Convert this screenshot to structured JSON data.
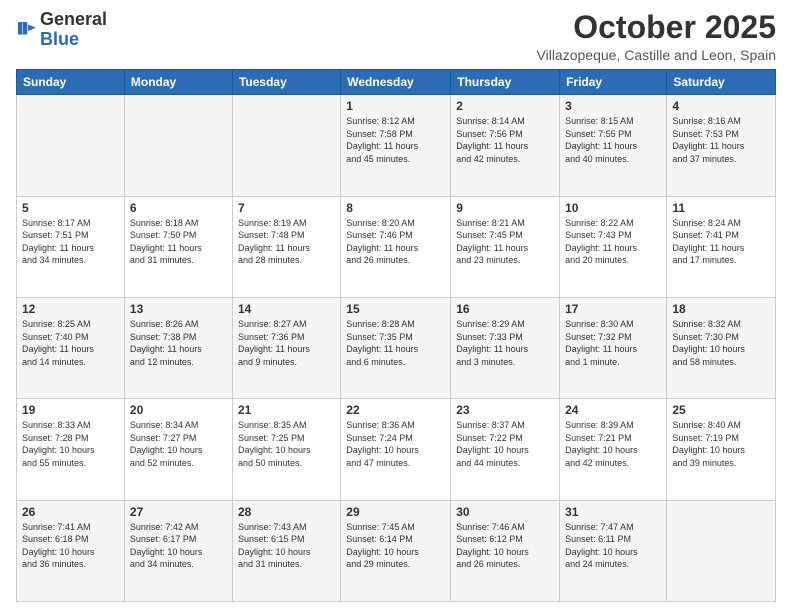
{
  "header": {
    "logo_general": "General",
    "logo_blue": "Blue",
    "month": "October 2025",
    "location": "Villazopeque, Castille and Leon, Spain"
  },
  "days_of_week": [
    "Sunday",
    "Monday",
    "Tuesday",
    "Wednesday",
    "Thursday",
    "Friday",
    "Saturday"
  ],
  "weeks": [
    [
      {
        "day": "",
        "info": ""
      },
      {
        "day": "",
        "info": ""
      },
      {
        "day": "",
        "info": ""
      },
      {
        "day": "1",
        "info": "Sunrise: 8:12 AM\nSunset: 7:58 PM\nDaylight: 11 hours\nand 45 minutes."
      },
      {
        "day": "2",
        "info": "Sunrise: 8:14 AM\nSunset: 7:56 PM\nDaylight: 11 hours\nand 42 minutes."
      },
      {
        "day": "3",
        "info": "Sunrise: 8:15 AM\nSunset: 7:55 PM\nDaylight: 11 hours\nand 40 minutes."
      },
      {
        "day": "4",
        "info": "Sunrise: 8:16 AM\nSunset: 7:53 PM\nDaylight: 11 hours\nand 37 minutes."
      }
    ],
    [
      {
        "day": "5",
        "info": "Sunrise: 8:17 AM\nSunset: 7:51 PM\nDaylight: 11 hours\nand 34 minutes."
      },
      {
        "day": "6",
        "info": "Sunrise: 8:18 AM\nSunset: 7:50 PM\nDaylight: 11 hours\nand 31 minutes."
      },
      {
        "day": "7",
        "info": "Sunrise: 8:19 AM\nSunset: 7:48 PM\nDaylight: 11 hours\nand 28 minutes."
      },
      {
        "day": "8",
        "info": "Sunrise: 8:20 AM\nSunset: 7:46 PM\nDaylight: 11 hours\nand 26 minutes."
      },
      {
        "day": "9",
        "info": "Sunrise: 8:21 AM\nSunset: 7:45 PM\nDaylight: 11 hours\nand 23 minutes."
      },
      {
        "day": "10",
        "info": "Sunrise: 8:22 AM\nSunset: 7:43 PM\nDaylight: 11 hours\nand 20 minutes."
      },
      {
        "day": "11",
        "info": "Sunrise: 8:24 AM\nSunset: 7:41 PM\nDaylight: 11 hours\nand 17 minutes."
      }
    ],
    [
      {
        "day": "12",
        "info": "Sunrise: 8:25 AM\nSunset: 7:40 PM\nDaylight: 11 hours\nand 14 minutes."
      },
      {
        "day": "13",
        "info": "Sunrise: 8:26 AM\nSunset: 7:38 PM\nDaylight: 11 hours\nand 12 minutes."
      },
      {
        "day": "14",
        "info": "Sunrise: 8:27 AM\nSunset: 7:36 PM\nDaylight: 11 hours\nand 9 minutes."
      },
      {
        "day": "15",
        "info": "Sunrise: 8:28 AM\nSunset: 7:35 PM\nDaylight: 11 hours\nand 6 minutes."
      },
      {
        "day": "16",
        "info": "Sunrise: 8:29 AM\nSunset: 7:33 PM\nDaylight: 11 hours\nand 3 minutes."
      },
      {
        "day": "17",
        "info": "Sunrise: 8:30 AM\nSunset: 7:32 PM\nDaylight: 11 hours\nand 1 minute."
      },
      {
        "day": "18",
        "info": "Sunrise: 8:32 AM\nSunset: 7:30 PM\nDaylight: 10 hours\nand 58 minutes."
      }
    ],
    [
      {
        "day": "19",
        "info": "Sunrise: 8:33 AM\nSunset: 7:28 PM\nDaylight: 10 hours\nand 55 minutes."
      },
      {
        "day": "20",
        "info": "Sunrise: 8:34 AM\nSunset: 7:27 PM\nDaylight: 10 hours\nand 52 minutes."
      },
      {
        "day": "21",
        "info": "Sunrise: 8:35 AM\nSunset: 7:25 PM\nDaylight: 10 hours\nand 50 minutes."
      },
      {
        "day": "22",
        "info": "Sunrise: 8:36 AM\nSunset: 7:24 PM\nDaylight: 10 hours\nand 47 minutes."
      },
      {
        "day": "23",
        "info": "Sunrise: 8:37 AM\nSunset: 7:22 PM\nDaylight: 10 hours\nand 44 minutes."
      },
      {
        "day": "24",
        "info": "Sunrise: 8:39 AM\nSunset: 7:21 PM\nDaylight: 10 hours\nand 42 minutes."
      },
      {
        "day": "25",
        "info": "Sunrise: 8:40 AM\nSunset: 7:19 PM\nDaylight: 10 hours\nand 39 minutes."
      }
    ],
    [
      {
        "day": "26",
        "info": "Sunrise: 7:41 AM\nSunset: 6:18 PM\nDaylight: 10 hours\nand 36 minutes."
      },
      {
        "day": "27",
        "info": "Sunrise: 7:42 AM\nSunset: 6:17 PM\nDaylight: 10 hours\nand 34 minutes."
      },
      {
        "day": "28",
        "info": "Sunrise: 7:43 AM\nSunset: 6:15 PM\nDaylight: 10 hours\nand 31 minutes."
      },
      {
        "day": "29",
        "info": "Sunrise: 7:45 AM\nSunset: 6:14 PM\nDaylight: 10 hours\nand 29 minutes."
      },
      {
        "day": "30",
        "info": "Sunrise: 7:46 AM\nSunset: 6:12 PM\nDaylight: 10 hours\nand 26 minutes."
      },
      {
        "day": "31",
        "info": "Sunrise: 7:47 AM\nSunset: 6:11 PM\nDaylight: 10 hours\nand 24 minutes."
      },
      {
        "day": "",
        "info": ""
      }
    ]
  ]
}
